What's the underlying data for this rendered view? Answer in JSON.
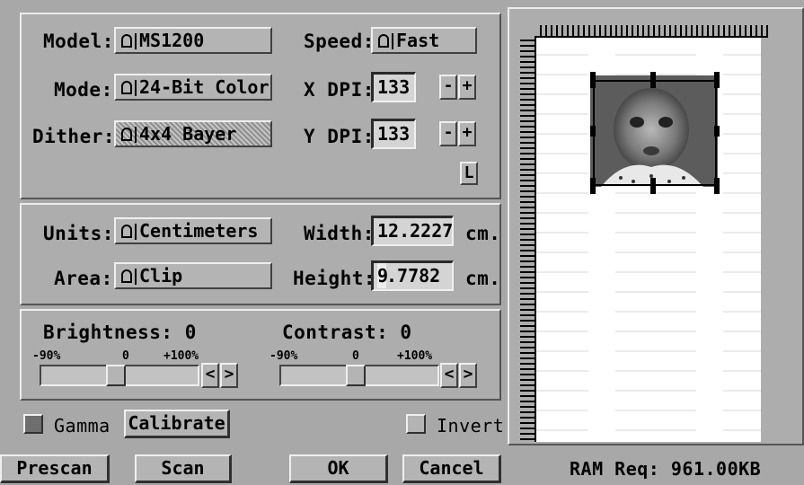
{
  "scanner": {
    "model_label": "Model:",
    "model_value": "MS1200",
    "speed_label": "Speed:",
    "speed_value": "Fast",
    "mode_label": "Mode:",
    "mode_value": "24-Bit Color",
    "xdpi_label": "X DPI:",
    "xdpi_value": "133",
    "dither_label": "Dither:",
    "dither_value": "4x4 Bayer",
    "ydpi_label": "Y DPI:",
    "ydpi_value": "133",
    "minus": "-",
    "plus": "+",
    "lock": "L"
  },
  "dimensions": {
    "units_label": "Units:",
    "units_value": "Centimeters",
    "width_label": "Width:",
    "width_value": "12.2227",
    "width_unit": "cm.",
    "area_label": "Area:",
    "area_value": "Clip",
    "height_label": "Height:",
    "height_value_first": "9",
    "height_value_rest": ".7782",
    "height_unit": "cm."
  },
  "adjust": {
    "brightness_label": "Brightness: 0",
    "contrast_label": "Contrast: 0",
    "scale_min": "-90%",
    "scale_mid": "0",
    "scale_max": "+100%",
    "left_arrow": "<",
    "right_arrow": ">",
    "brightness_level": 0,
    "contrast_level": 0
  },
  "options": {
    "gamma_label": "Gamma",
    "calibrate_label": "Calibrate",
    "invert_label": "Invert",
    "gamma_checked": true,
    "invert_checked": false
  },
  "buttons": {
    "prescan": "Prescan",
    "scan": "Scan",
    "ok": "OK",
    "cancel": "Cancel"
  },
  "status": {
    "ram": "RAM Req: 961.00KB"
  },
  "colors": {
    "face": "#adadad",
    "gamma_on": "#6e6e6e"
  }
}
